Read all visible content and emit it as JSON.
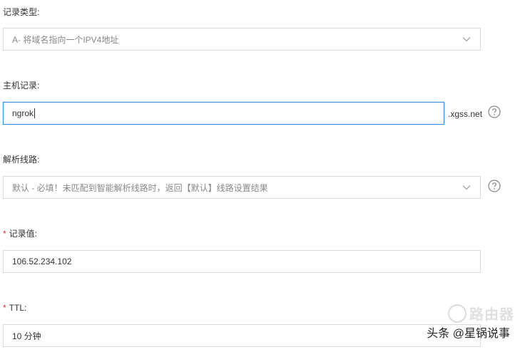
{
  "record_type": {
    "label": "记录类型:",
    "selected": "A- 将域名指向一个IPV4地址"
  },
  "host_record": {
    "label": "主机记录:",
    "value": "ngrok",
    "suffix": ".xgss.net"
  },
  "resolve_line": {
    "label": "解析线路:",
    "selected": "默认 - 必填！未匹配到智能解析线路时，返回【默认】线路设置结果"
  },
  "record_value": {
    "required_mark": "*",
    "label": "记录值:",
    "value": "106.52.234.102"
  },
  "ttl": {
    "required_mark": "*",
    "label": "TTL:",
    "selected": "10 分钟"
  },
  "watermark": {
    "logo_text": "路由器",
    "caption": "头条 @星锅说事"
  },
  "colors": {
    "focus_border": "#3a8ee6",
    "required": "#d9363e"
  },
  "icons": {
    "dropdown": "chevron-down-icon",
    "help": "question-circle-icon"
  }
}
